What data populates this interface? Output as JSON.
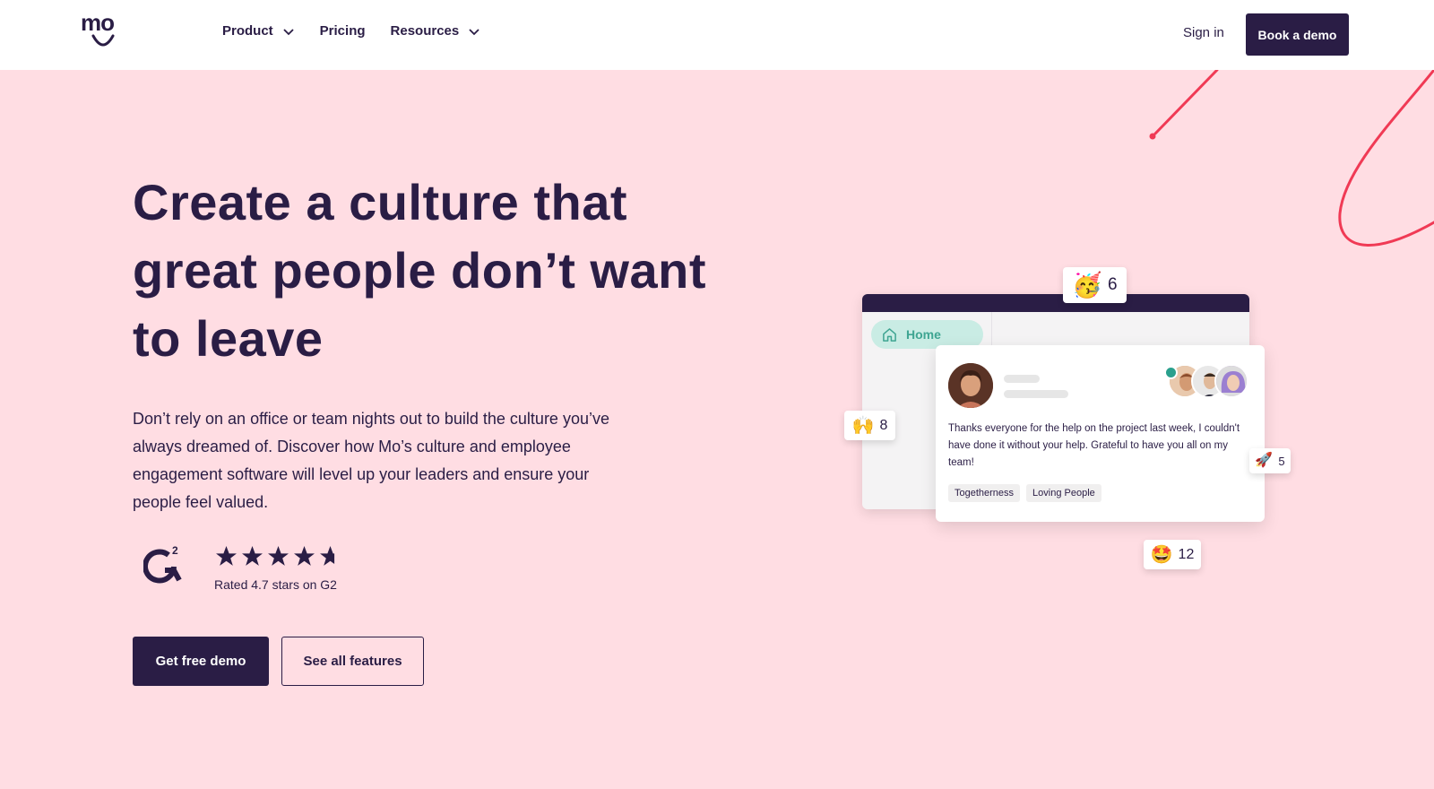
{
  "nav": {
    "logo_text": "mo",
    "items": [
      {
        "label": "Product",
        "has_dropdown": true
      },
      {
        "label": "Pricing",
        "has_dropdown": false
      },
      {
        "label": "Resources",
        "has_dropdown": true
      }
    ],
    "signin_label": "Sign in",
    "demo_label": "Book a demo"
  },
  "hero": {
    "title": "Create a culture that great people don’t want to leave",
    "description": "Don’t rely on an office or team nights out to build the culture you’ve always dreamed of. Discover how Mo’s culture and employee engagement software will level up your leaders and ensure your people feel valued.",
    "rating": {
      "value": 4.7,
      "max": 5,
      "text": "Rated 4.7 stars on G2"
    },
    "primary_cta": "Get free demo",
    "secondary_cta": "See all features"
  },
  "illustration": {
    "nav_label": "Home",
    "post_text": "Thanks everyone for the help on the project last week, I couldn't have done it without your help. Grateful to have you all on my team!",
    "tags": [
      "Togetherness",
      "Loving People"
    ],
    "reactions": [
      {
        "emoji": "🥳",
        "count": "6"
      },
      {
        "emoji": "🙌",
        "count": "8"
      },
      {
        "emoji": "🚀",
        "count": "5"
      },
      {
        "emoji": "🤩",
        "count": "12"
      }
    ]
  },
  "colors": {
    "brand_dark": "#2a1d45",
    "hero_bg": "#ffdde3",
    "accent_red": "#f03a55",
    "accent_teal": "#3fa592"
  }
}
